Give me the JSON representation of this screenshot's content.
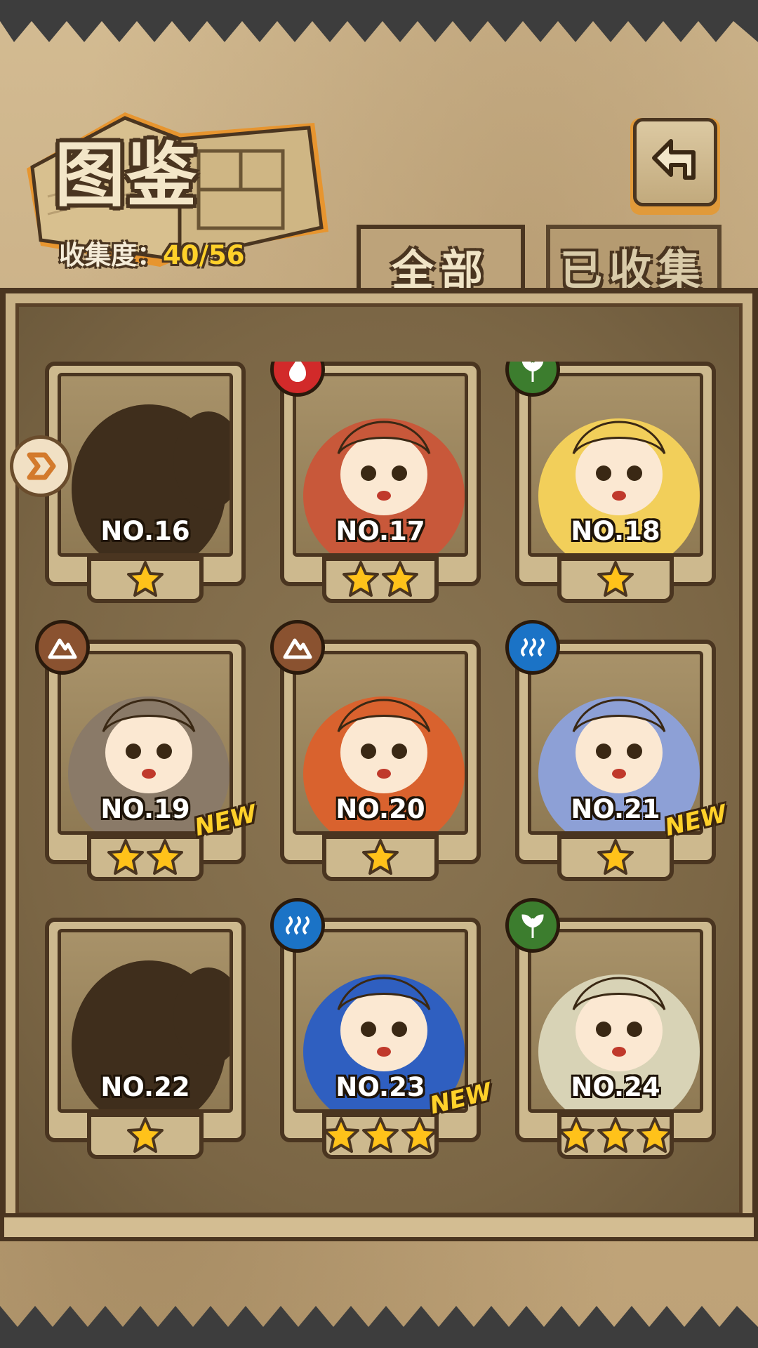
{
  "header": {
    "title": "图鉴",
    "collection_label": "收集度：",
    "collection_value": "40/56"
  },
  "tabs": [
    {
      "label": "全部",
      "selected": true
    },
    {
      "label": "已收集",
      "selected": false
    }
  ],
  "cards": [
    {
      "number": "NO.16",
      "stars": 1,
      "element": null,
      "locked": true,
      "is_new": false,
      "art_color": "#3f2e1c"
    },
    {
      "number": "NO.17",
      "stars": 2,
      "element": "fire",
      "locked": false,
      "is_new": false,
      "art_color": "#c8583a"
    },
    {
      "number": "NO.18",
      "stars": 1,
      "element": "leaf",
      "locked": false,
      "is_new": false,
      "art_color": "#f2cf5a"
    },
    {
      "number": "NO.19",
      "stars": 2,
      "element": "earth",
      "locked": false,
      "is_new": true,
      "art_color": "#8a7a68"
    },
    {
      "number": "NO.20",
      "stars": 1,
      "element": "earth",
      "locked": false,
      "is_new": false,
      "art_color": "#d9622e"
    },
    {
      "number": "NO.21",
      "stars": 1,
      "element": "water",
      "locked": false,
      "is_new": true,
      "art_color": "#8da0d6"
    },
    {
      "number": "NO.22",
      "stars": 1,
      "element": null,
      "locked": true,
      "is_new": false,
      "art_color": "#3f2e1c"
    },
    {
      "number": "NO.23",
      "stars": 3,
      "element": "water",
      "locked": false,
      "is_new": true,
      "art_color": "#2f5fc0"
    },
    {
      "number": "NO.24",
      "stars": 3,
      "element": "leaf",
      "locked": false,
      "is_new": false,
      "art_color": "#d8d3b6"
    }
  ],
  "new_badge_label": "NEW",
  "colors": {
    "fire": "#d22a2a",
    "leaf": "#3c7d2e",
    "earth": "#8a5230",
    "water": "#1b73c6",
    "star": "#ffc21a",
    "accent": "#ffd12a"
  }
}
